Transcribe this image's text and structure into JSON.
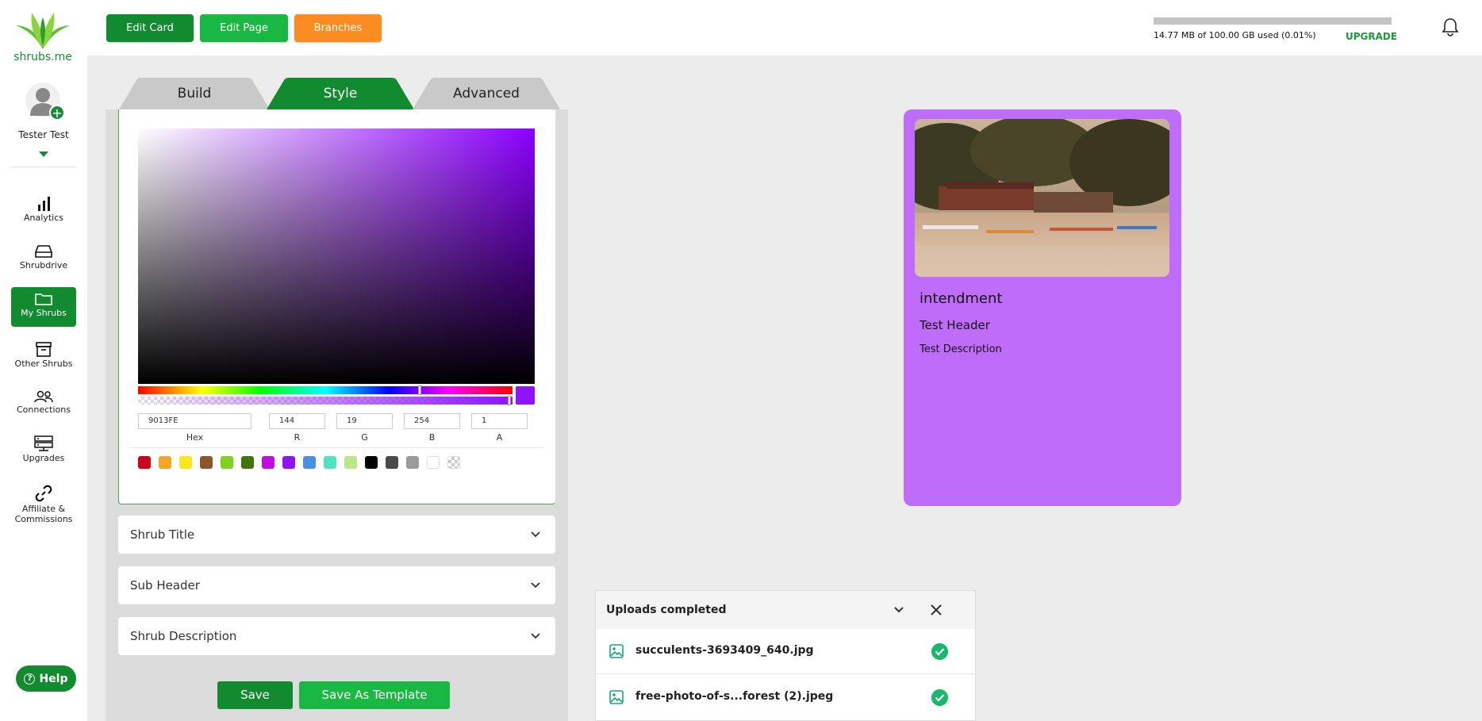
{
  "brand": {
    "name": "shrubs.me"
  },
  "user": {
    "name": "Tester Test"
  },
  "nav": [
    {
      "label": "Analytics",
      "icon": "bar-chart-icon",
      "active": false
    },
    {
      "label": "Shrubdrive",
      "icon": "drive-icon",
      "active": false
    },
    {
      "label": "My Shrubs",
      "icon": "folder-icon",
      "active": true
    },
    {
      "label": "Other Shrubs",
      "icon": "archive-icon",
      "active": false
    },
    {
      "label": "Connections",
      "icon": "people-icon",
      "active": false
    },
    {
      "label": "Upgrades",
      "icon": "server-icon",
      "active": false
    },
    {
      "label": "Affiliate & Commissions",
      "icon": "link-icon",
      "active": false
    }
  ],
  "help": {
    "label": "Help"
  },
  "topbar": {
    "buttons": [
      {
        "label": "Edit Card",
        "color": "#128a30"
      },
      {
        "label": "Edit Page",
        "color": "#19b843"
      },
      {
        "label": "Branches",
        "color": "#fb8c22"
      }
    ],
    "storage": {
      "text": "14.77 MB of 100.00 GB used (0.01%)",
      "used_fraction": 0.0001,
      "upgrade_label": "UPGRADE"
    }
  },
  "tabs": [
    {
      "label": "Build",
      "active": false
    },
    {
      "label": "Style",
      "active": true
    },
    {
      "label": "Advanced",
      "active": false
    }
  ],
  "color_picker": {
    "hex": "9013FE",
    "r": "144",
    "g": "19",
    "b": "254",
    "a": "1",
    "labels": {
      "hex": "Hex",
      "r": "R",
      "g": "G",
      "b": "B",
      "a": "A"
    },
    "presets": [
      "#d0021b",
      "#f5a623",
      "#f8e71c",
      "#8b572a",
      "#7ed321",
      "#417505",
      "#bd10e0",
      "#9013fe",
      "#4a90e2",
      "#50e3c2",
      "#b8e986",
      "#000000",
      "#4a4a4a",
      "#9b9b9b",
      "#ffffff",
      "transparent"
    ]
  },
  "accordions": [
    {
      "label": "Shrub Title"
    },
    {
      "label": "Sub Header"
    },
    {
      "label": "Shrub Description"
    }
  ],
  "actions": {
    "save": "Save",
    "save_template": "Save As Template"
  },
  "card": {
    "background": "#c06cfa",
    "title": "intendment",
    "sub_header": "Test Header",
    "description": "Test Description"
  },
  "uploads": {
    "title": "Uploads completed",
    "files": [
      {
        "name": "succulents-3693409_640.jpg"
      },
      {
        "name": "free-photo-of-s...forest (2).jpeg"
      }
    ]
  }
}
